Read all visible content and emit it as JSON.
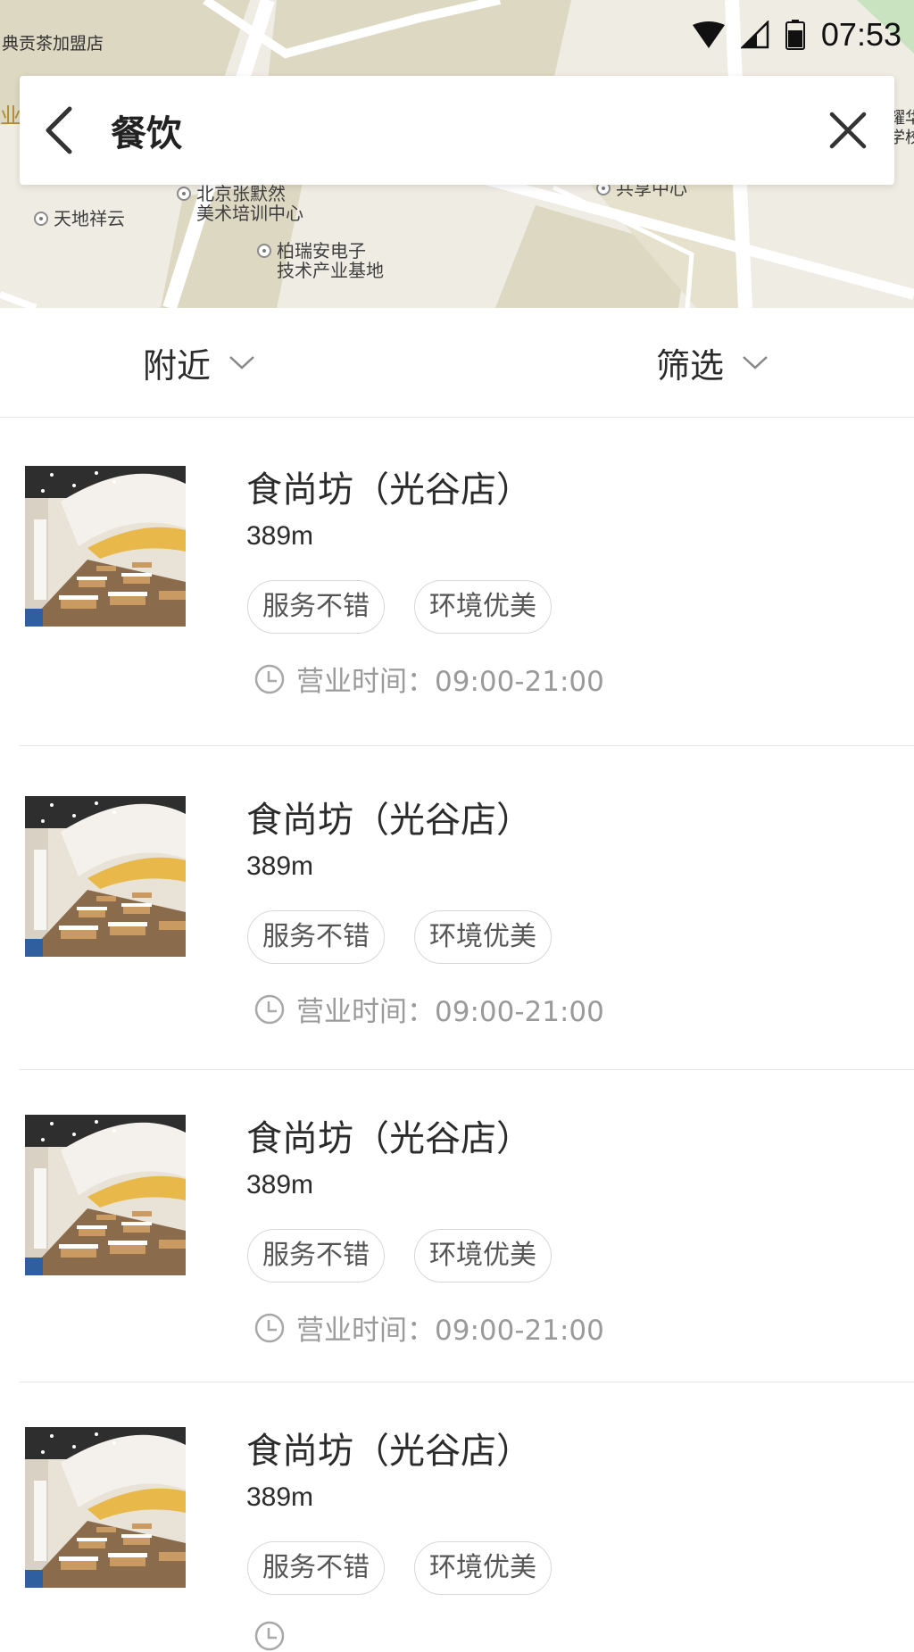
{
  "status_bar": {
    "time": "07:53"
  },
  "map": {
    "pois": [
      {
        "label": "北京张默然\n美术培训中心"
      },
      {
        "label": "天地祥云"
      },
      {
        "label": "柏瑞安电子\n技术产业基地"
      },
      {
        "label": "共享中心"
      }
    ],
    "corner_text": "典贡茶加盟店",
    "edge_text_left": "业",
    "edge_text_right": "耀华\n学校"
  },
  "search": {
    "query": "餐饮"
  },
  "filters": {
    "nearby": "附近",
    "filter": "筛选"
  },
  "list": [
    {
      "name": "食尚坊（光谷店）",
      "distance": "389m",
      "tags": [
        "服务不错",
        "环境优美"
      ],
      "hours": "营业时间：09:00-21:00"
    },
    {
      "name": "食尚坊（光谷店）",
      "distance": "389m",
      "tags": [
        "服务不错",
        "环境优美"
      ],
      "hours": "营业时间：09:00-21:00"
    },
    {
      "name": "食尚坊（光谷店）",
      "distance": "389m",
      "tags": [
        "服务不错",
        "环境优美"
      ],
      "hours": "营业时间：09:00-21:00"
    },
    {
      "name": "食尚坊（光谷店）",
      "distance": "389m",
      "tags": [
        "服务不错",
        "环境优美"
      ],
      "hours": ""
    }
  ],
  "colors": {
    "map_bg": "#efece4",
    "map_block": "#ddd8c2",
    "road": "#ffffff",
    "divider": "#e4e4e4",
    "muted_text": "#9a9a9a"
  },
  "icons": {
    "back": "chevron-left-icon",
    "close": "close-icon",
    "dropdown": "chevron-down-icon",
    "clock": "clock-icon",
    "wifi": "wifi-icon",
    "signal": "signal-icon",
    "battery": "battery-icon"
  }
}
